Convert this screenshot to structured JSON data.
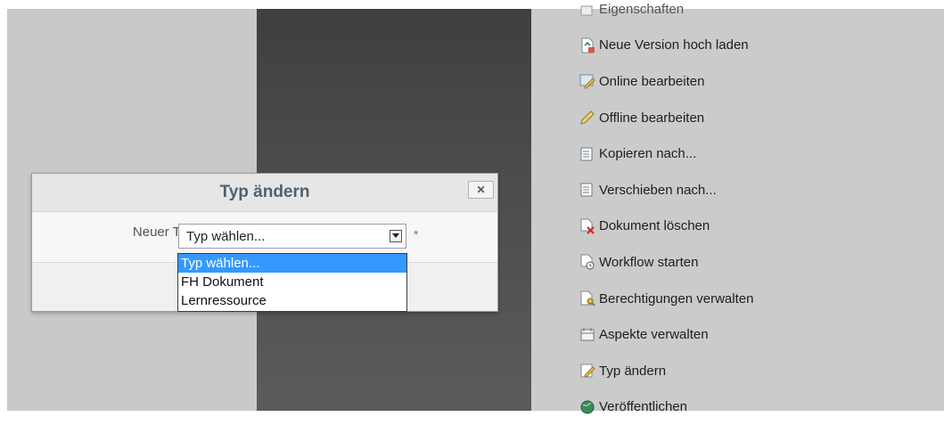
{
  "menu": {
    "items": [
      {
        "label": "Eigenschaften",
        "icon": "properties-icon"
      },
      {
        "label": "Neue Version hoch laden",
        "icon": "upload-version-icon"
      },
      {
        "label": "Online bearbeiten",
        "icon": "online-edit-icon"
      },
      {
        "label": "Offline bearbeiten",
        "icon": "pencil-icon"
      },
      {
        "label": "Kopieren nach...",
        "icon": "copy-icon"
      },
      {
        "label": "Verschieben nach...",
        "icon": "move-icon"
      },
      {
        "label": "Dokument löschen",
        "icon": "delete-document-icon"
      },
      {
        "label": "Workflow starten",
        "icon": "workflow-icon"
      },
      {
        "label": "Berechtigungen verwalten",
        "icon": "permissions-icon"
      },
      {
        "label": "Aspekte verwalten",
        "icon": "aspects-icon"
      },
      {
        "label": "Typ ändern",
        "icon": "change-type-icon"
      },
      {
        "label": "Veröffentlichen",
        "icon": "publish-icon"
      }
    ]
  },
  "dialog": {
    "title": "Typ ändern",
    "close_symbol": "✕",
    "field_label": "Neuer Typ:",
    "select_value": "Typ wählen...",
    "required_marker": "*",
    "options": [
      "Typ wählen...",
      "FH Dokument",
      "Lernressource"
    ],
    "selected_index": 0
  }
}
